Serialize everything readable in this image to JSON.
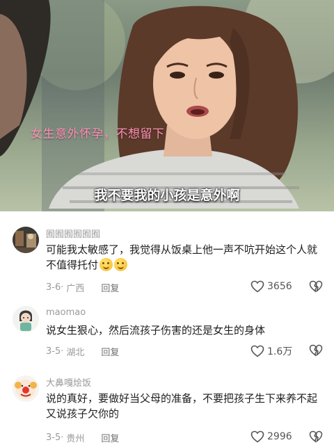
{
  "video": {
    "caption_top": "女生意外怀孕，不想留下",
    "caption_bottom": "我不要我的小孩是意外啊"
  },
  "comments": [
    {
      "username": "囿囿囿囿囿囿",
      "text": "可能我太敏感了，我觉得从饭桌上他一声不吭开始这个人就不值得托付",
      "emojis": [
        "grin-emoji",
        "grin-emoji"
      ],
      "date": "3-6",
      "location": "广西",
      "reply_label": "回复",
      "likes": "3656"
    },
    {
      "username": "maomao",
      "text": "说女生狠心，然后流孩子伤害的还是女生的身体",
      "date": "3-5",
      "location": "湖北",
      "reply_label": "回复",
      "likes": "1.6万"
    },
    {
      "username": "大鼻嘎烩饭",
      "text": "说的真好，要做好当父母的准备，不要把孩子生下来养不起又说孩子欠你的",
      "date": "3-5",
      "location": "贵州",
      "reply_label": "回复",
      "likes": "2996"
    }
  ]
}
